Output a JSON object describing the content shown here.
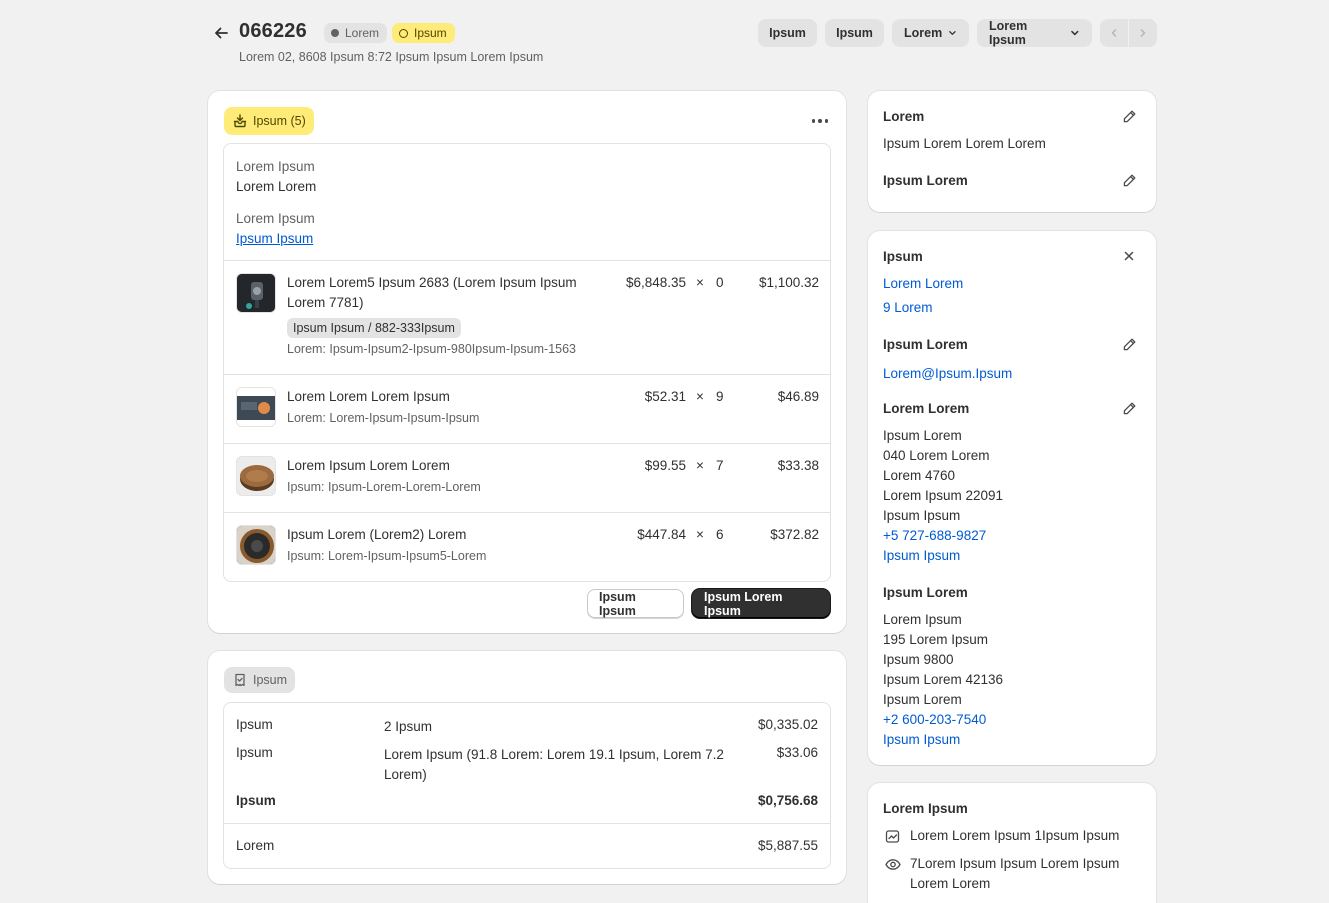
{
  "header": {
    "order_number": "066226",
    "status_badge_1": "Lorem",
    "status_badge_2": "Ipsum",
    "subtitle": "Lorem 02, 8608 Ipsum 8:72 Ipsum Ipsum Lorem Ipsum",
    "actions": {
      "btn1": "Ipsum",
      "btn2": "Ipsum",
      "btn3": "Lorem",
      "btn4": "Lorem Ipsum"
    }
  },
  "fulfillment": {
    "badge": "Ipsum (5)",
    "location_label": "Lorem Ipsum",
    "location_value": "Lorem Lorem",
    "delivery_label": "Lorem Ipsum",
    "delivery_link": "Ipsum Ipsum",
    "items": [
      {
        "name_line1": "Lorem Lorem5 Ipsum 2683 (Lorem Ipsum Ipsum",
        "name_line2": "Lorem 7781)",
        "variant": "Ipsum Ipsum / 882-333Ipsum",
        "meta": "Lorem: Ipsum-Ipsum2-Ipsum-980Ipsum-Ipsum-1563",
        "price": "$6,848.35",
        "x": "×",
        "qty": "0",
        "total": "$1,100.32"
      },
      {
        "name_line1": "Lorem Lorem Lorem Ipsum",
        "meta": "Lorem: Lorem-Ipsum-Ipsum-Ipsum",
        "price": "$52.31",
        "x": "×",
        "qty": "9",
        "total": "$46.89"
      },
      {
        "name_line1": "Lorem Ipsum Lorem Lorem",
        "meta": "Ipsum: Ipsum-Lorem-Lorem-Lorem",
        "price": "$99.55",
        "x": "×",
        "qty": "7",
        "total": "$33.38"
      },
      {
        "name_line1": "Ipsum Lorem (Lorem2) Lorem",
        "meta": "Ipsum: Lorem-Ipsum-Ipsum5-Lorem",
        "price": "$447.84",
        "x": "×",
        "qty": "6",
        "total": "$372.82"
      }
    ],
    "btn_secondary": "Ipsum Ipsum",
    "btn_primary": "Ipsum Lorem Ipsum"
  },
  "payment": {
    "badge": "Ipsum",
    "rows": [
      {
        "label": "Ipsum",
        "desc": "2 Ipsum",
        "amount": "$0,335.02"
      },
      {
        "label": "Ipsum",
        "desc_line1": "Lorem Ipsum (91.8 Lorem: Lorem 19.1 Ipsum, Lorem 7.2",
        "desc_line2": "Lorem)",
        "amount": "$33.06"
      },
      {
        "label": "Ipsum",
        "amount": "$0,756.68"
      }
    ],
    "footer": {
      "label": "Lorem",
      "amount": "$5,887.55"
    }
  },
  "sidebar": {
    "notes": {
      "title": "Lorem",
      "text": "Ipsum Lorem Lorem Lorem",
      "attr_title": "Ipsum Lorem"
    },
    "customer": {
      "title": "Ipsum",
      "name_link": "Lorem Lorem",
      "orders_link": "9 Lorem",
      "contact_title": "Ipsum Lorem",
      "email": "Lorem@Ipsum.Ipsum",
      "shipping_title": "Lorem Lorem",
      "shipping_lines": [
        "Ipsum Lorem",
        "040 Lorem Lorem",
        "Lorem 4760",
        "Lorem Ipsum 22091",
        "Ipsum Ipsum"
      ],
      "shipping_phone": "+5 727-688-9827",
      "shipping_map": "Ipsum Ipsum",
      "billing_title": "Ipsum Lorem",
      "billing_lines": [
        "Lorem Ipsum",
        "195 Lorem Ipsum",
        "Ipsum 9800",
        "Ipsum Lorem 42136",
        "Ipsum Lorem"
      ],
      "billing_phone": "+2 600-203-7540",
      "billing_map": "Ipsum Ipsum"
    },
    "conversion": {
      "title": "Lorem Ipsum",
      "row1": "Lorem Lorem Ipsum 1Ipsum Ipsum",
      "row2_line1": "7Lorem Ipsum Ipsum Lorem Ipsum",
      "row2_line2": "Lorem Lorem"
    }
  },
  "colors": {
    "background": "#f1f1f1",
    "badge_yellow": "#ffeb78",
    "link_blue": "#005bd3",
    "primary_button": "#303030"
  },
  "icons": [
    "arrow-left-icon",
    "dot-icon",
    "ring-icon",
    "chevron-down-icon",
    "chevron-left-icon",
    "chevron-right-icon",
    "fulfillment-icon",
    "more-icon",
    "receipt-icon",
    "pencil-icon",
    "close-icon",
    "conversion-icon",
    "eye-icon"
  ]
}
